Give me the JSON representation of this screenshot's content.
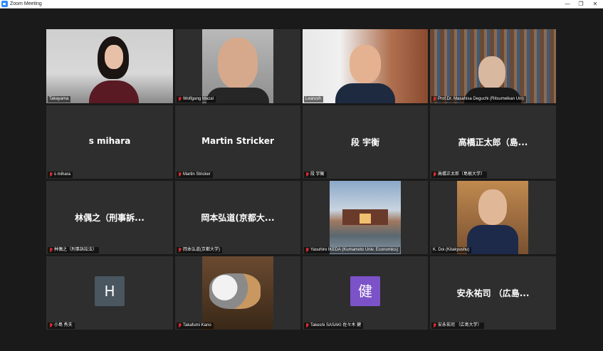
{
  "window": {
    "title": "Zoom Meeting",
    "minimize": "—",
    "restore": "❐",
    "close": "✕"
  },
  "colors": {
    "tile_bg": "#2e2e2e",
    "active_speaker": "#9bd13c",
    "muted": "#e02828",
    "avatar_h": "#4a5660",
    "avatar_ken": "#7c52c8"
  },
  "participants": [
    {
      "label": "Takayama",
      "type": "video",
      "active": true
    },
    {
      "label": "Wolfgang Mazal",
      "type": "video"
    },
    {
      "label": "Learush",
      "type": "video"
    },
    {
      "label": "Prof.Dr. Masahisa Deguchi (Ritsumeikan Uni)",
      "type": "video"
    },
    {
      "display_name": "s mihara",
      "label": "s mihara",
      "type": "name"
    },
    {
      "display_name": "Martin Stricker",
      "label": "Martin Stricker",
      "type": "name"
    },
    {
      "display_name": "段 宇衡",
      "label": "段 宇衡",
      "type": "name"
    },
    {
      "display_name": "高橋正太郎（島...",
      "label": "高橋正太郎（島根大学）",
      "type": "name"
    },
    {
      "display_name": "林偶之（刑事訴...",
      "label": "林偶之（刑事訴訟法）",
      "type": "name"
    },
    {
      "display_name": "岡本弘道(京都大...",
      "label": "岡本弘道(京都大学)",
      "type": "name"
    },
    {
      "label": "Yasuhiro IKEDA (Kumamoto Univ. Economics)",
      "type": "image"
    },
    {
      "label": "K. Doi (Kitakyushu)",
      "type": "video"
    },
    {
      "avatar_letter": "H",
      "label": "小島 秀夫",
      "type": "avatar"
    },
    {
      "label": "Takafumi Kano",
      "type": "image"
    },
    {
      "avatar_letter": "健",
      "label": "Takeshi SASAKI 佐々木 健",
      "type": "avatar"
    },
    {
      "display_name": "安永祐司 （広島...",
      "label": "安永祐司 （広島大学）",
      "type": "name"
    }
  ]
}
